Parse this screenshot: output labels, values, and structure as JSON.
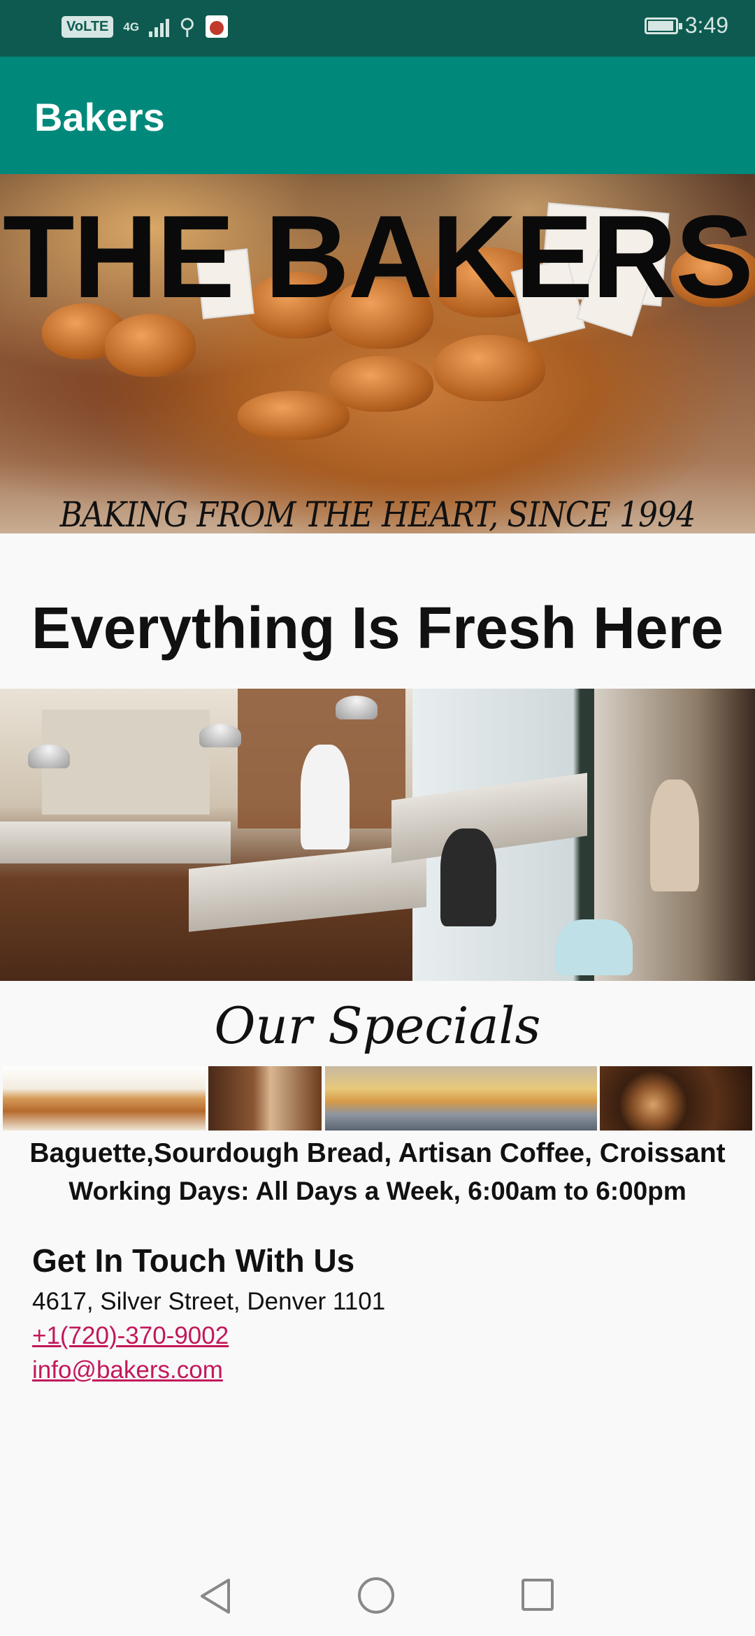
{
  "status_bar": {
    "volte": "VoLTE",
    "network": "4G",
    "time": "3:49"
  },
  "app_bar": {
    "title": "Bakers"
  },
  "hero": {
    "title": "THE BAKERS",
    "tagline": "BAKING FROM THE HEART, SINCE 1994"
  },
  "main": {
    "fresh_heading": "Everything Is Fresh Here",
    "specials_heading": "Our Specials",
    "specials_list": "Baguette,Sourdough Bread, Artisan Coffee, Croissant",
    "working_days": "Working Days: All Days a Week, 6:00am to 6:00pm"
  },
  "contact": {
    "heading": "Get In Touch With Us",
    "address": "4617, Silver Street, Denver 1101",
    "phone": "+1(720)-370-9002",
    "email": "info@bakers.com"
  },
  "icons": {
    "usb": "usb-icon",
    "battery": "battery-icon",
    "back": "back-icon",
    "home": "home-icon",
    "recent": "recent-apps-icon"
  },
  "colors": {
    "status_bar": "#0e5a50",
    "app_bar": "#00897b",
    "link": "#c2185b",
    "background": "#f9f9f9"
  }
}
